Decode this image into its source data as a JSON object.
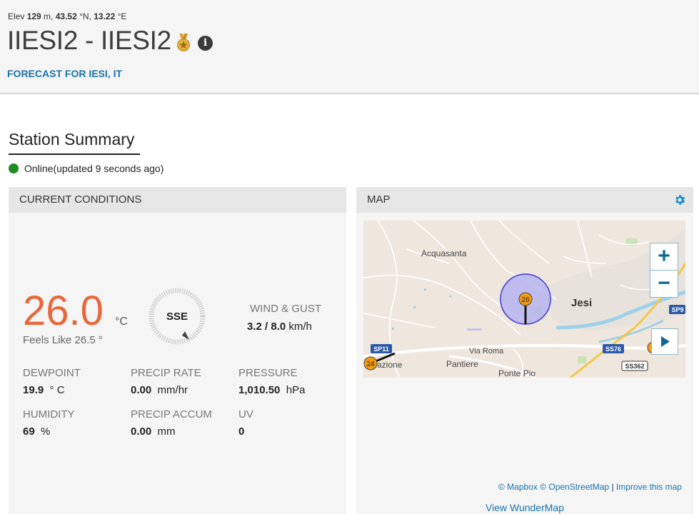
{
  "header": {
    "elev_prefix": "Elev",
    "elev_value": "129",
    "elev_unit": " m,",
    "lat_value": "43.52",
    "lat_unit": " °N,",
    "lon_value": "13.22",
    "lon_unit": " °E",
    "station_title": "IIESI2 - IIESI2",
    "forecast_link": "FORECAST FOR IESI, IT"
  },
  "summary": {
    "title": "Station Summary",
    "status": "Online(updated 9 seconds ago)",
    "status_color": "#1e8e20"
  },
  "current": {
    "heading": "CURRENT CONDITIONS",
    "temperature": "26.0",
    "temperature_unit": "°C",
    "feels_like": "Feels Like 26.5 °",
    "wind_dir": "SSE",
    "wind_label": "WIND & GUST",
    "wind_speed": "3.2",
    "wind_gust": " / 8.0",
    "wind_unit": " km/h",
    "dewpoint_label": "DEWPOINT",
    "dewpoint_value": "19.9",
    "dewpoint_unit": "° C",
    "precip_rate_label": "PRECIP RATE",
    "precip_rate_value": "0.00",
    "precip_rate_unit": "mm/hr",
    "pressure_label": "PRESSURE",
    "pressure_value": "1,010.50",
    "pressure_unit": "hPa",
    "humidity_label": "HUMIDITY",
    "humidity_value": "69",
    "humidity_unit": "%",
    "precip_accum_label": "PRECIP ACCUM",
    "precip_accum_value": "0.00",
    "precip_accum_unit": "mm",
    "uv_label": "UV",
    "uv_value": "0",
    "temp_color": "#e8683c"
  },
  "map": {
    "heading": "MAP",
    "places": {
      "acquasanta": "Acquasanta",
      "jesi": "Jesi",
      "via_roma": "Via Roma",
      "pantiere": "Pantiere",
      "ponte_pio": "Ponte Pio",
      "azione": "azione"
    },
    "road_badges": {
      "sp11": "SP11",
      "ss76": "SS76",
      "sp9": "SP9",
      "ss362": "SS362"
    },
    "markers": {
      "main": "26",
      "left": "24"
    },
    "zoom_in": "+",
    "zoom_out": "−",
    "attrib_mapbox": "© Mapbox",
    "attrib_osm": "© OpenStreetMap",
    "attrib_sep": " | ",
    "attrib_improve": "Improve this map",
    "view_link": "View WunderMap"
  }
}
